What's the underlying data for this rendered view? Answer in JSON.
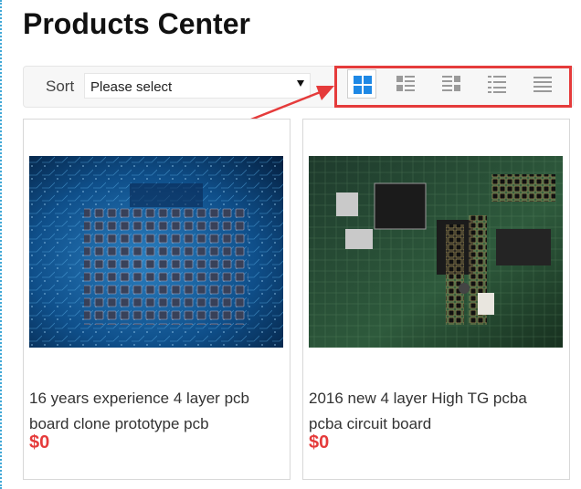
{
  "page": {
    "title": "Products Center"
  },
  "toolbar": {
    "sort_label": "Sort",
    "sort_value": "Please select",
    "view_modes": [
      {
        "icon": "grid-view-icon",
        "active": true
      },
      {
        "icon": "list-thumb-view-icon",
        "active": false
      },
      {
        "icon": "detail-view-icon",
        "active": false
      },
      {
        "icon": "compact-list-view-icon",
        "active": false
      },
      {
        "icon": "lines-view-icon",
        "active": false
      }
    ]
  },
  "annotation": {
    "color": "#e53b3b"
  },
  "products": [
    {
      "title": "16 years experience 4 layer pcb board clone prototype pcb",
      "price": "$0",
      "image": "blue-pcb-photo"
    },
    {
      "title": "2016 new 4 layer High TG pcba pcba circuit board",
      "price": "$0",
      "image": "green-pcb-photo"
    }
  ],
  "colors": {
    "accent": "#1e88e5",
    "price": "#e53b3b"
  }
}
